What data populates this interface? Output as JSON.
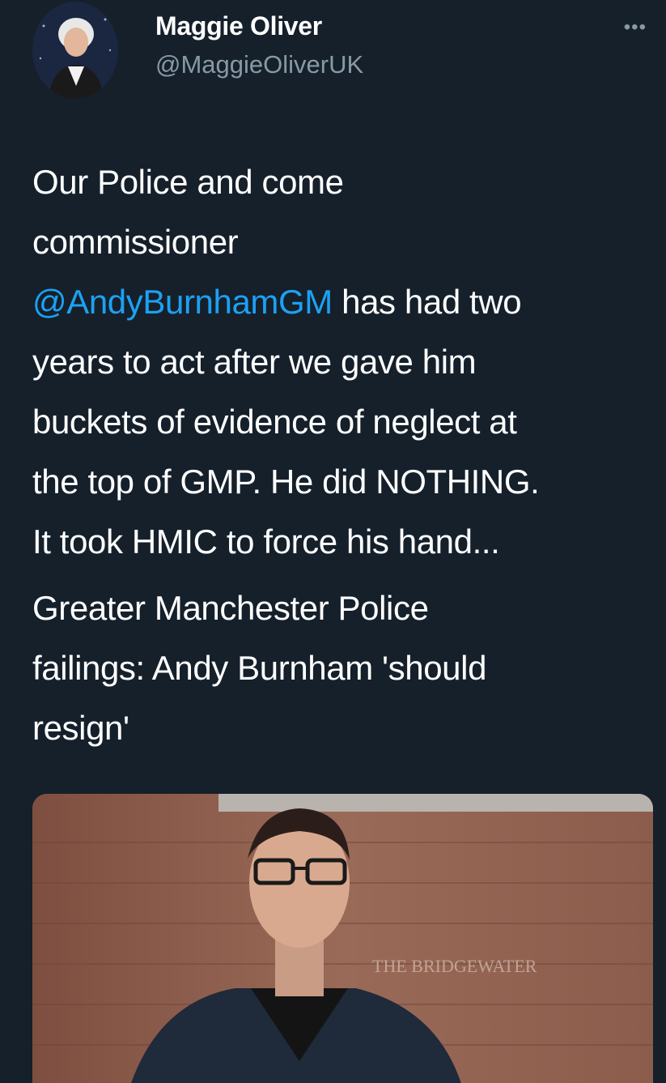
{
  "author": {
    "display_name": "Maggie Oliver",
    "handle": "@MaggieOliverUK",
    "avatar_icon": "profile-photo"
  },
  "more_icon": "more-dots-icon",
  "more_label": "•••",
  "tweet": {
    "lines": [
      "Our Police and come",
      "commissioner",
      "has had two",
      "years to act after we gave him",
      "buckets of evidence of neglect at",
      "the top of GMP. He did NOTHING.",
      "It took HMIC to force his hand..."
    ],
    "mention": "@AndyBurnhamGM"
  },
  "link_card": {
    "title_lines": [
      "Greater Manchester Police",
      "failings: Andy Burnham 'should",
      "resign'"
    ],
    "image_icon": "news-photo",
    "image_sign_text": "THE BRIDGEWATER"
  },
  "colors": {
    "background": "#15202b",
    "text": "#ffffff",
    "secondary_text": "#8899a6",
    "link": "#1da1f2"
  }
}
